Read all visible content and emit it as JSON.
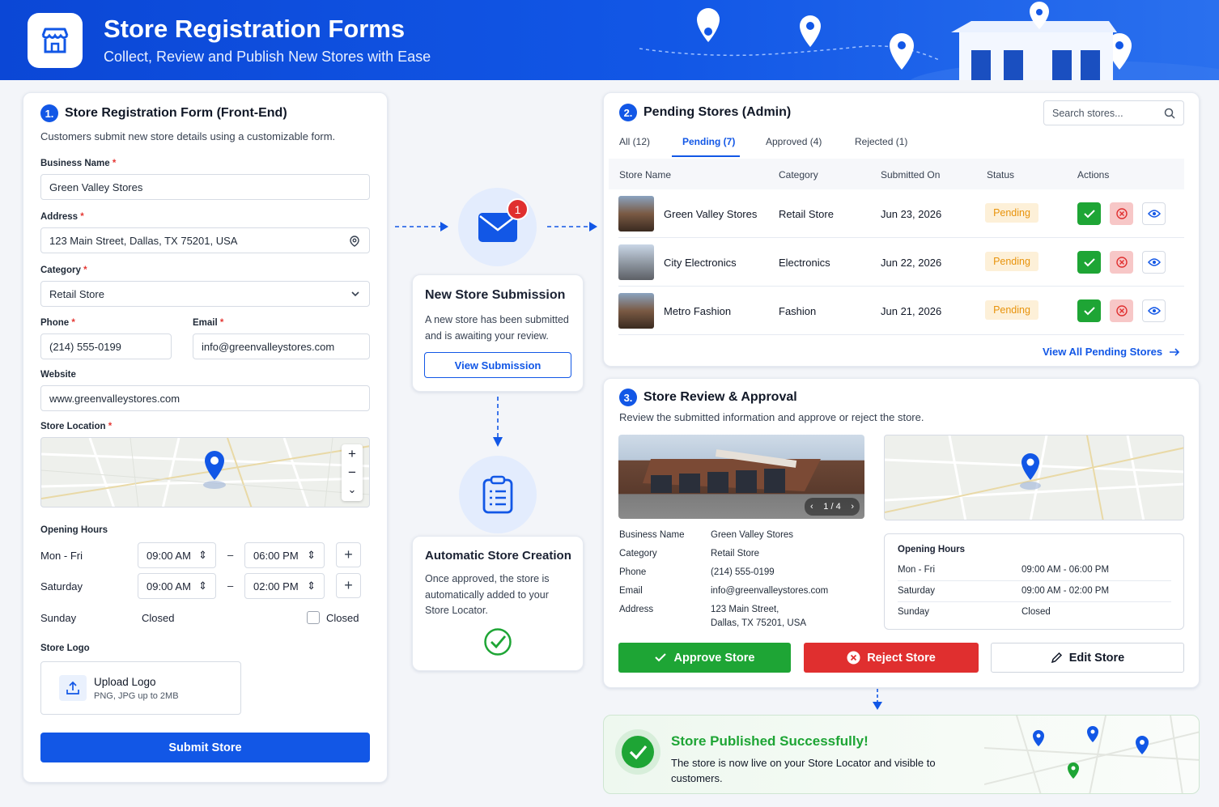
{
  "header": {
    "title": "Store Registration Forms",
    "subtitle": "Collect, Review and Publish New Stores with Ease"
  },
  "form": {
    "step": "1.",
    "title": "Store Registration Form (Front-End)",
    "desc": "Customers submit new store details using a customizable form.",
    "business_name_label": "Business Name",
    "business_name": "Green Valley Stores",
    "address_label": "Address",
    "address": "123 Main Street, Dallas, TX 75201, USA",
    "category_label": "Category",
    "category": "Retail Store",
    "phone_label": "Phone",
    "phone": "(214) 555-0199",
    "email_label": "Email",
    "email": "info@greenvalleystores.com",
    "website_label": "Website",
    "website": "www.greenvalleystores.com",
    "location_label": "Store Location",
    "map_controls": {
      "zoom_in": "+",
      "zoom_out": "−",
      "other": "⌄"
    },
    "hours_label": "Opening Hours",
    "hours": [
      {
        "day": "Mon - Fri",
        "open": "09:00 AM",
        "close": "06:00 PM"
      },
      {
        "day": "Saturday",
        "open": "09:00 AM",
        "close": "02:00 PM"
      }
    ],
    "hours_dash": "–",
    "sunday": {
      "day": "Sunday",
      "status": "Closed",
      "checkbox_label": "Closed"
    },
    "logo_label": "Store Logo",
    "upload_title": "Upload Logo",
    "upload_hint": "PNG, JPG up to 2MB",
    "submit": "Submit Store",
    "required_mark": "*"
  },
  "notification": {
    "badge": "1",
    "title": "New Store Submission",
    "text": "A new store has been submitted and is awaiting your review.",
    "button": "View Submission"
  },
  "automation": {
    "title": "Automatic Store Creation",
    "text": "Once approved, the store is automatically added to your Store Locator."
  },
  "pending": {
    "step": "2.",
    "title": "Pending Stores (Admin)",
    "search_placeholder": "Search stores...",
    "tabs": [
      "All (12)",
      "Pending (7)",
      "Approved (4)",
      "Rejected (1)"
    ],
    "active_tab": 1,
    "columns": [
      "Store Name",
      "Category",
      "Submitted On",
      "Status",
      "Actions"
    ],
    "rows": [
      {
        "name": "Green Valley Stores",
        "category": "Retail Store",
        "date": "Jun 23, 2026",
        "status": "Pending"
      },
      {
        "name": "City Electronics",
        "category": "Electronics",
        "date": "Jun 22, 2026",
        "status": "Pending"
      },
      {
        "name": "Metro Fashion",
        "category": "Fashion",
        "date": "Jun 21, 2026",
        "status": "Pending"
      }
    ],
    "view_all": "View All Pending Stores"
  },
  "review": {
    "step": "3.",
    "title": "Store Review & Approval",
    "desc": "Review the submitted information and approve or reject the store.",
    "gallery_counter": "1 / 4",
    "details": [
      {
        "k": "Business Name",
        "v": "Green Valley Stores"
      },
      {
        "k": "Category",
        "v": "Retail Store"
      },
      {
        "k": "Phone",
        "v": "(214) 555-0199"
      },
      {
        "k": "Email",
        "v": "info@greenvalleystores.com"
      },
      {
        "k": "Address",
        "v": "123 Main Street,"
      },
      {
        "k": "",
        "v": "Dallas, TX 75201, USA"
      }
    ],
    "hours_title": "Opening Hours",
    "hours": [
      {
        "day": "Mon - Fri",
        "time": "09:00 AM - 06:00 PM"
      },
      {
        "day": "Saturday",
        "time": "09:00 AM - 02:00 PM"
      },
      {
        "day": "Sunday",
        "time": "Closed"
      }
    ],
    "approve": "Approve Store",
    "reject": "Reject Store",
    "edit": "Edit Store"
  },
  "published": {
    "title": "Store Published Successfully!",
    "text": "The store is now live on your Store Locator and visible to customers."
  },
  "colors": {
    "primary": "#1257e6",
    "success": "#1ea535",
    "danger": "#e02f2f",
    "pending_bg": "#fdf0d8",
    "pending_fg": "#e8930c"
  }
}
